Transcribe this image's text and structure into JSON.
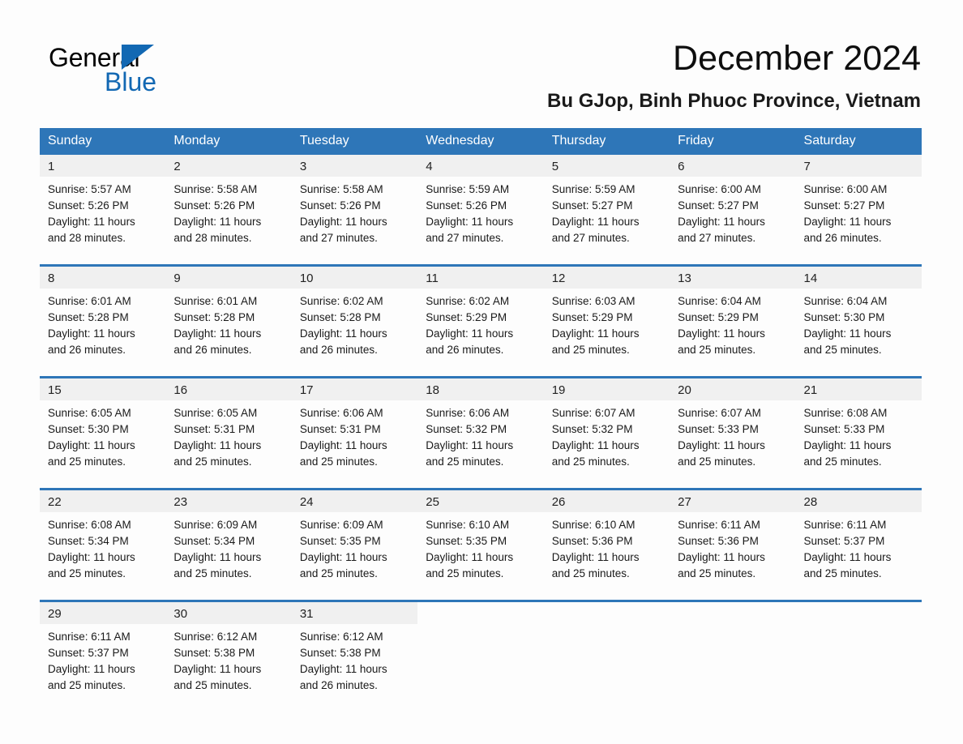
{
  "brand": {
    "name_part1": "General",
    "name_part2": "Blue",
    "triangle_color": "#1268b3"
  },
  "header": {
    "title": "December 2024",
    "subtitle": "Bu GJop, Binh Phuoc Province, Vietnam"
  },
  "theme": {
    "header_blue": "#2e76b8",
    "daynum_band": "#f0f0f0",
    "page_background": "#fdfdfd"
  },
  "weekdays": [
    "Sunday",
    "Monday",
    "Tuesday",
    "Wednesday",
    "Thursday",
    "Friday",
    "Saturday"
  ],
  "weeks": [
    [
      {
        "day": "1",
        "sunrise": "Sunrise: 5:57 AM",
        "sunset": "Sunset: 5:26 PM",
        "daylight1": "Daylight: 11 hours",
        "daylight2": "and 28 minutes."
      },
      {
        "day": "2",
        "sunrise": "Sunrise: 5:58 AM",
        "sunset": "Sunset: 5:26 PM",
        "daylight1": "Daylight: 11 hours",
        "daylight2": "and 28 minutes."
      },
      {
        "day": "3",
        "sunrise": "Sunrise: 5:58 AM",
        "sunset": "Sunset: 5:26 PM",
        "daylight1": "Daylight: 11 hours",
        "daylight2": "and 27 minutes."
      },
      {
        "day": "4",
        "sunrise": "Sunrise: 5:59 AM",
        "sunset": "Sunset: 5:26 PM",
        "daylight1": "Daylight: 11 hours",
        "daylight2": "and 27 minutes."
      },
      {
        "day": "5",
        "sunrise": "Sunrise: 5:59 AM",
        "sunset": "Sunset: 5:27 PM",
        "daylight1": "Daylight: 11 hours",
        "daylight2": "and 27 minutes."
      },
      {
        "day": "6",
        "sunrise": "Sunrise: 6:00 AM",
        "sunset": "Sunset: 5:27 PM",
        "daylight1": "Daylight: 11 hours",
        "daylight2": "and 27 minutes."
      },
      {
        "day": "7",
        "sunrise": "Sunrise: 6:00 AM",
        "sunset": "Sunset: 5:27 PM",
        "daylight1": "Daylight: 11 hours",
        "daylight2": "and 26 minutes."
      }
    ],
    [
      {
        "day": "8",
        "sunrise": "Sunrise: 6:01 AM",
        "sunset": "Sunset: 5:28 PM",
        "daylight1": "Daylight: 11 hours",
        "daylight2": "and 26 minutes."
      },
      {
        "day": "9",
        "sunrise": "Sunrise: 6:01 AM",
        "sunset": "Sunset: 5:28 PM",
        "daylight1": "Daylight: 11 hours",
        "daylight2": "and 26 minutes."
      },
      {
        "day": "10",
        "sunrise": "Sunrise: 6:02 AM",
        "sunset": "Sunset: 5:28 PM",
        "daylight1": "Daylight: 11 hours",
        "daylight2": "and 26 minutes."
      },
      {
        "day": "11",
        "sunrise": "Sunrise: 6:02 AM",
        "sunset": "Sunset: 5:29 PM",
        "daylight1": "Daylight: 11 hours",
        "daylight2": "and 26 minutes."
      },
      {
        "day": "12",
        "sunrise": "Sunrise: 6:03 AM",
        "sunset": "Sunset: 5:29 PM",
        "daylight1": "Daylight: 11 hours",
        "daylight2": "and 25 minutes."
      },
      {
        "day": "13",
        "sunrise": "Sunrise: 6:04 AM",
        "sunset": "Sunset: 5:29 PM",
        "daylight1": "Daylight: 11 hours",
        "daylight2": "and 25 minutes."
      },
      {
        "day": "14",
        "sunrise": "Sunrise: 6:04 AM",
        "sunset": "Sunset: 5:30 PM",
        "daylight1": "Daylight: 11 hours",
        "daylight2": "and 25 minutes."
      }
    ],
    [
      {
        "day": "15",
        "sunrise": "Sunrise: 6:05 AM",
        "sunset": "Sunset: 5:30 PM",
        "daylight1": "Daylight: 11 hours",
        "daylight2": "and 25 minutes."
      },
      {
        "day": "16",
        "sunrise": "Sunrise: 6:05 AM",
        "sunset": "Sunset: 5:31 PM",
        "daylight1": "Daylight: 11 hours",
        "daylight2": "and 25 minutes."
      },
      {
        "day": "17",
        "sunrise": "Sunrise: 6:06 AM",
        "sunset": "Sunset: 5:31 PM",
        "daylight1": "Daylight: 11 hours",
        "daylight2": "and 25 minutes."
      },
      {
        "day": "18",
        "sunrise": "Sunrise: 6:06 AM",
        "sunset": "Sunset: 5:32 PM",
        "daylight1": "Daylight: 11 hours",
        "daylight2": "and 25 minutes."
      },
      {
        "day": "19",
        "sunrise": "Sunrise: 6:07 AM",
        "sunset": "Sunset: 5:32 PM",
        "daylight1": "Daylight: 11 hours",
        "daylight2": "and 25 minutes."
      },
      {
        "day": "20",
        "sunrise": "Sunrise: 6:07 AM",
        "sunset": "Sunset: 5:33 PM",
        "daylight1": "Daylight: 11 hours",
        "daylight2": "and 25 minutes."
      },
      {
        "day": "21",
        "sunrise": "Sunrise: 6:08 AM",
        "sunset": "Sunset: 5:33 PM",
        "daylight1": "Daylight: 11 hours",
        "daylight2": "and 25 minutes."
      }
    ],
    [
      {
        "day": "22",
        "sunrise": "Sunrise: 6:08 AM",
        "sunset": "Sunset: 5:34 PM",
        "daylight1": "Daylight: 11 hours",
        "daylight2": "and 25 minutes."
      },
      {
        "day": "23",
        "sunrise": "Sunrise: 6:09 AM",
        "sunset": "Sunset: 5:34 PM",
        "daylight1": "Daylight: 11 hours",
        "daylight2": "and 25 minutes."
      },
      {
        "day": "24",
        "sunrise": "Sunrise: 6:09 AM",
        "sunset": "Sunset: 5:35 PM",
        "daylight1": "Daylight: 11 hours",
        "daylight2": "and 25 minutes."
      },
      {
        "day": "25",
        "sunrise": "Sunrise: 6:10 AM",
        "sunset": "Sunset: 5:35 PM",
        "daylight1": "Daylight: 11 hours",
        "daylight2": "and 25 minutes."
      },
      {
        "day": "26",
        "sunrise": "Sunrise: 6:10 AM",
        "sunset": "Sunset: 5:36 PM",
        "daylight1": "Daylight: 11 hours",
        "daylight2": "and 25 minutes."
      },
      {
        "day": "27",
        "sunrise": "Sunrise: 6:11 AM",
        "sunset": "Sunset: 5:36 PM",
        "daylight1": "Daylight: 11 hours",
        "daylight2": "and 25 minutes."
      },
      {
        "day": "28",
        "sunrise": "Sunrise: 6:11 AM",
        "sunset": "Sunset: 5:37 PM",
        "daylight1": "Daylight: 11 hours",
        "daylight2": "and 25 minutes."
      }
    ],
    [
      {
        "day": "29",
        "sunrise": "Sunrise: 6:11 AM",
        "sunset": "Sunset: 5:37 PM",
        "daylight1": "Daylight: 11 hours",
        "daylight2": "and 25 minutes."
      },
      {
        "day": "30",
        "sunrise": "Sunrise: 6:12 AM",
        "sunset": "Sunset: 5:38 PM",
        "daylight1": "Daylight: 11 hours",
        "daylight2": "and 25 minutes."
      },
      {
        "day": "31",
        "sunrise": "Sunrise: 6:12 AM",
        "sunset": "Sunset: 5:38 PM",
        "daylight1": "Daylight: 11 hours",
        "daylight2": "and 26 minutes."
      },
      {
        "day": "",
        "sunrise": "",
        "sunset": "",
        "daylight1": "",
        "daylight2": ""
      },
      {
        "day": "",
        "sunrise": "",
        "sunset": "",
        "daylight1": "",
        "daylight2": ""
      },
      {
        "day": "",
        "sunrise": "",
        "sunset": "",
        "daylight1": "",
        "daylight2": ""
      },
      {
        "day": "",
        "sunrise": "",
        "sunset": "",
        "daylight1": "",
        "daylight2": ""
      }
    ]
  ]
}
